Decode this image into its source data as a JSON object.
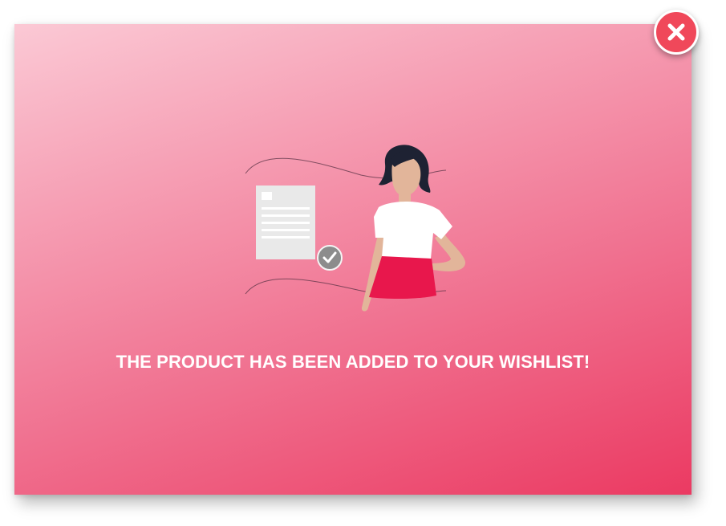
{
  "dialog": {
    "message": "THE PRODUCT HAS BEEN ADDED TO YOUR WISHLIST!",
    "close_icon": "close-icon",
    "illustration_icon": "woman-with-checked-document-illustration"
  },
  "colors": {
    "gradient_top": "#fbc9d5",
    "gradient_bottom": "#eb3a62",
    "close_button": "#f0485a",
    "skirt": "#e8174c",
    "hair": "#1e2233",
    "skin": "#e2b59a",
    "check_badge": "#8c8c8c",
    "document": "#e9e9e9"
  }
}
